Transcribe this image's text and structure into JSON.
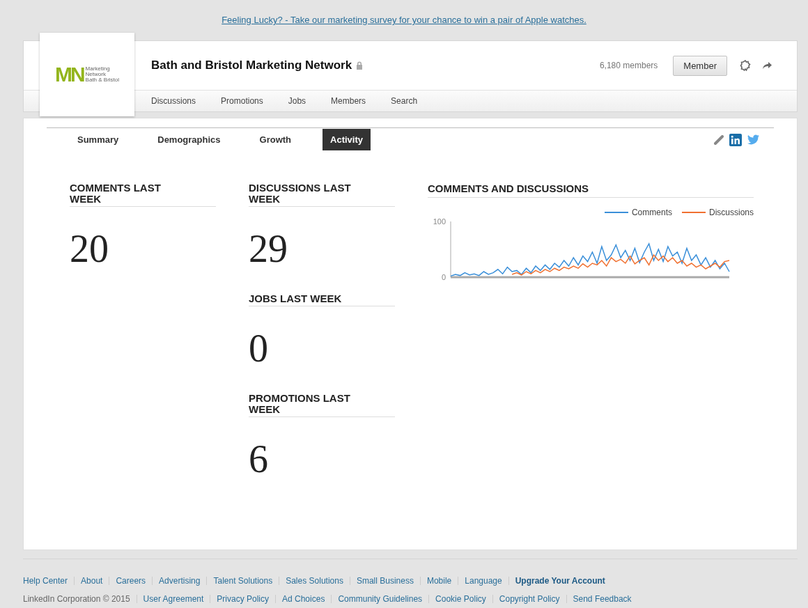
{
  "banner": {
    "link": "Feeling Lucky? - Take our marketing survey for your chance to win a pair of Apple watches."
  },
  "group": {
    "logo": {
      "mark": "MN",
      "lines": [
        "Marketing",
        "Network",
        "Bath & Bristol"
      ]
    },
    "name": "Bath and Bristol Marketing Network",
    "members": "6,180 members",
    "member_button": "Member"
  },
  "group_nav": [
    "Discussions",
    "Promotions",
    "Jobs",
    "Members",
    "Search"
  ],
  "tabs": [
    {
      "label": "Summary",
      "selected": false
    },
    {
      "label": "Demographics",
      "selected": false
    },
    {
      "label": "Growth",
      "selected": false
    },
    {
      "label": "Activity",
      "selected": true
    }
  ],
  "stats_left": [
    {
      "title": "COMMENTS LAST WEEK",
      "value": "20"
    }
  ],
  "stats_middle": [
    {
      "title": "DISCUSSIONS LAST WEEK",
      "value": "29"
    },
    {
      "title": "JOBS LAST WEEK",
      "value": "0"
    },
    {
      "title": "PROMOTIONS LAST WEEK",
      "value": "6"
    }
  ],
  "chart": {
    "title": "COMMENTS AND DISCUSSIONS",
    "chart_data": {
      "type": "line",
      "ylim": [
        0,
        100
      ],
      "yticks": [
        0,
        100
      ],
      "series": [
        {
          "name": "Comments",
          "color": "#3a8fd9",
          "values": [
            2,
            5,
            3,
            8,
            4,
            6,
            3,
            10,
            5,
            8,
            14,
            6,
            18,
            10,
            12,
            5,
            16,
            8,
            20,
            12,
            22,
            14,
            25,
            18,
            30,
            20,
            35,
            22,
            38,
            28,
            45,
            25,
            55,
            30,
            40,
            58,
            35,
            48,
            30,
            52,
            26,
            45,
            60,
            30,
            50,
            28,
            55,
            38,
            45,
            25,
            52,
            30,
            40,
            22,
            35,
            18,
            30,
            15,
            25,
            10
          ]
        },
        {
          "name": "Discussions",
          "color": "#f07030",
          "values": [
            null,
            null,
            null,
            null,
            null,
            null,
            null,
            null,
            null,
            null,
            null,
            null,
            null,
            5,
            8,
            4,
            10,
            6,
            12,
            8,
            14,
            10,
            16,
            12,
            18,
            15,
            20,
            16,
            24,
            18,
            25,
            22,
            30,
            20,
            35,
            28,
            32,
            25,
            38,
            24,
            30,
            35,
            22,
            40,
            30,
            38,
            28,
            35,
            25,
            30,
            20,
            25,
            18,
            22,
            15,
            20,
            25,
            18,
            28,
            30
          ]
        }
      ]
    }
  },
  "footer": {
    "row1": [
      {
        "label": "Help Center",
        "bold": false
      },
      {
        "label": "About",
        "bold": false
      },
      {
        "label": "Careers",
        "bold": false
      },
      {
        "label": "Advertising",
        "bold": false
      },
      {
        "label": "Talent Solutions",
        "bold": false
      },
      {
        "label": "Sales Solutions",
        "bold": false
      },
      {
        "label": "Small Business",
        "bold": false
      },
      {
        "label": "Mobile",
        "bold": false
      },
      {
        "label": "Language",
        "bold": false
      },
      {
        "label": "Upgrade Your Account",
        "bold": true
      }
    ],
    "copyright": "LinkedIn Corporation © 2015",
    "row2": [
      "User Agreement",
      "Privacy Policy",
      "Ad Choices",
      "Community Guidelines",
      "Cookie Policy",
      "Copyright Policy",
      "Send Feedback"
    ]
  }
}
